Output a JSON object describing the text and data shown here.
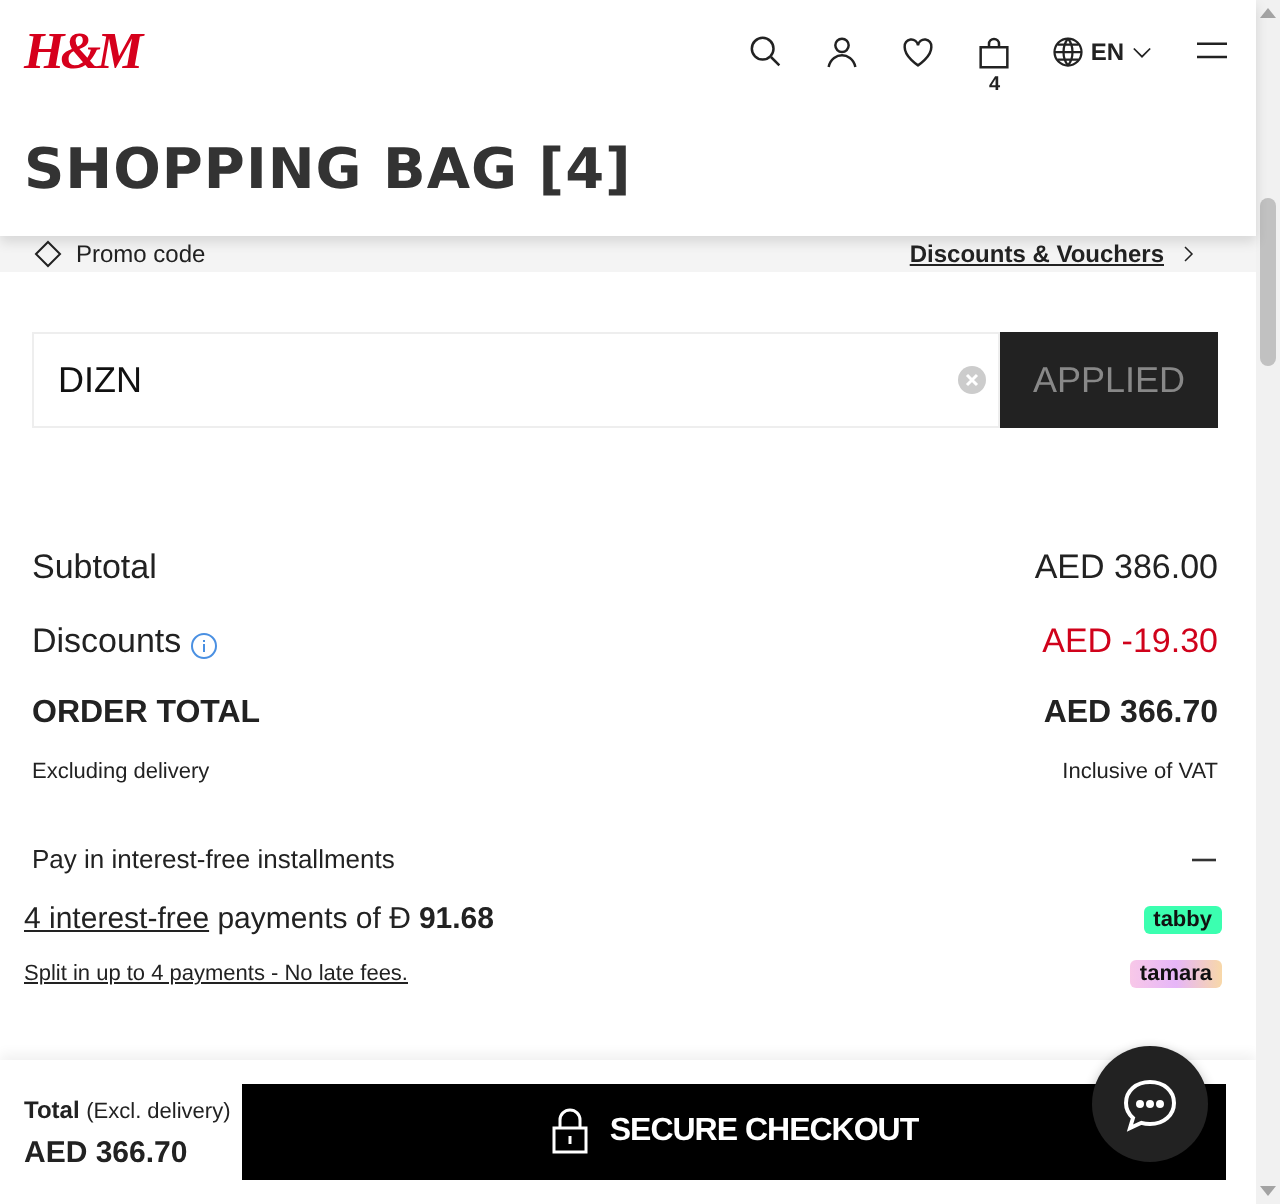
{
  "header": {
    "logo": "H&M",
    "bag_count": "4",
    "language": "EN"
  },
  "title": "SHOPPING BAG [4]",
  "promo": {
    "label": "Promo code",
    "link": "Discounts & Vouchers"
  },
  "promo_field": {
    "value": "DIZN",
    "button": "APPLIED"
  },
  "summary": [
    {
      "label": "Subtotal",
      "value": "AED 386.00",
      "kind": "plain"
    },
    {
      "label": "Discounts",
      "value": "AED -19.30",
      "kind": "discount"
    },
    {
      "label": "ORDER TOTAL",
      "value": "AED 366.70",
      "kind": "total"
    }
  ],
  "notes": {
    "left": "Excluding delivery",
    "right": "Inclusive of VAT"
  },
  "installments": {
    "title": "Pay in interest-free installments",
    "expanded": true,
    "tabby": {
      "link": "4 interest-free",
      "text": "payments of",
      "currency": "Ð",
      "amount": "91.68",
      "badge": "tabby"
    },
    "tamara": {
      "link": "Split in up to 4 payments - No late fees.",
      "badge": "tamara"
    }
  },
  "footer": {
    "label": "Total",
    "note": "(Excl. delivery)",
    "amount": "AED 366.70",
    "button": "SECURE CHECKOUT"
  }
}
